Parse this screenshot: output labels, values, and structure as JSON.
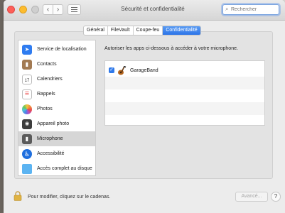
{
  "window": {
    "title": "Sécurité et confidentialité"
  },
  "search": {
    "placeholder": "Rechercher",
    "value": ""
  },
  "tabs": [
    {
      "label": "Général",
      "active": false
    },
    {
      "label": "FileVault",
      "active": false
    },
    {
      "label": "Coupe-feu",
      "active": false
    },
    {
      "label": "Confidentialité",
      "active": true
    }
  ],
  "sidebar": {
    "items": [
      {
        "label": "Service de localisation",
        "icon": "location-arrow-icon",
        "selected": false
      },
      {
        "label": "Contacts",
        "icon": "contacts-book-icon",
        "selected": false
      },
      {
        "label": "Calendriers",
        "icon": "calendar-icon",
        "selected": false
      },
      {
        "label": "Rappels",
        "icon": "reminders-list-icon",
        "selected": false
      },
      {
        "label": "Photos",
        "icon": "photos-flower-icon",
        "selected": false
      },
      {
        "label": "Appareil photo",
        "icon": "camera-icon",
        "selected": false
      },
      {
        "label": "Microphone",
        "icon": "microphone-icon",
        "selected": true
      },
      {
        "label": "Accessibilité",
        "icon": "accessibility-icon",
        "selected": false
      },
      {
        "label": "Accès complet au disque",
        "icon": "folder-icon",
        "selected": false
      }
    ],
    "calendar_day": "17"
  },
  "main": {
    "description": "Autoriser les apps ci-dessous à accéder à votre microphone.",
    "apps": [
      {
        "name": "GarageBand",
        "checked": true,
        "icon": "garageband-guitar-icon"
      }
    ]
  },
  "footer": {
    "lock_text": "Pour modifier, cliquez sur le cadenas.",
    "advanced_label": "Avancé...",
    "help_label": "?"
  },
  "colors": {
    "accent": "#2f79ea",
    "selected_row": "#d6d6d6",
    "close": "#fd5e57",
    "minimize": "#fdbc2e"
  }
}
